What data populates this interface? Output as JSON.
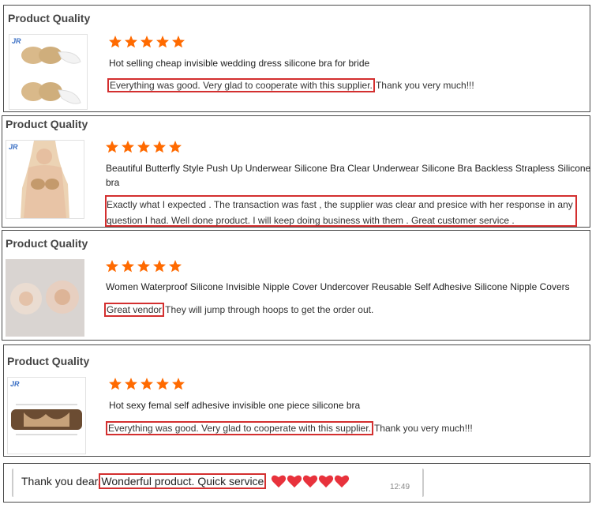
{
  "section_title": "Product Quality",
  "rating_stars": 5,
  "star_color": "#ff6a00",
  "highlight_color": "#d32f2f",
  "reviews": [
    {
      "product_title": "Hot selling cheap invisible wedding dress silicone bra for bride",
      "highlighted": "Everything was good. Very glad to cooperate with this supplier.",
      "rest": " Thank you very much!!!",
      "thumb": "bra-cups-icon"
    },
    {
      "product_title_line1": "Beautiful Butterfly Style Push Up Underwear Silicone Bra Clear Underwear Silicone Bra Backless Strapless Silicone",
      "product_title_line2": "bra",
      "highlighted_line1": "Exactly what I expected . The transaction was fast , the supplier was clear and presice with her response in any",
      "highlighted_line2": "question I had. Well done product. I will keep doing business with them . Great customer service .",
      "thumb": "model-photo-icon"
    },
    {
      "product_title": "Women Waterproof Silicone Invisible Nipple Cover Undercover Reusable Self Adhesive Silicone Nipple Covers",
      "highlighted": "Great vendor",
      "rest": " They will jump through hoops to get the order out.",
      "thumb": "nipple-covers-icon"
    },
    {
      "product_title": "Hot sexy femal self adhesive invisible one piece silicone bra",
      "highlighted": "Everything was good. Very glad to cooperate with this supplier.",
      "rest": " Thank you very much!!!",
      "thumb": "bra-band-icon"
    }
  ],
  "chat": {
    "prefix": "Thank you dear.",
    "highlighted": "Wonderful product. Quick service",
    "hearts": 5,
    "time": "12:49"
  }
}
